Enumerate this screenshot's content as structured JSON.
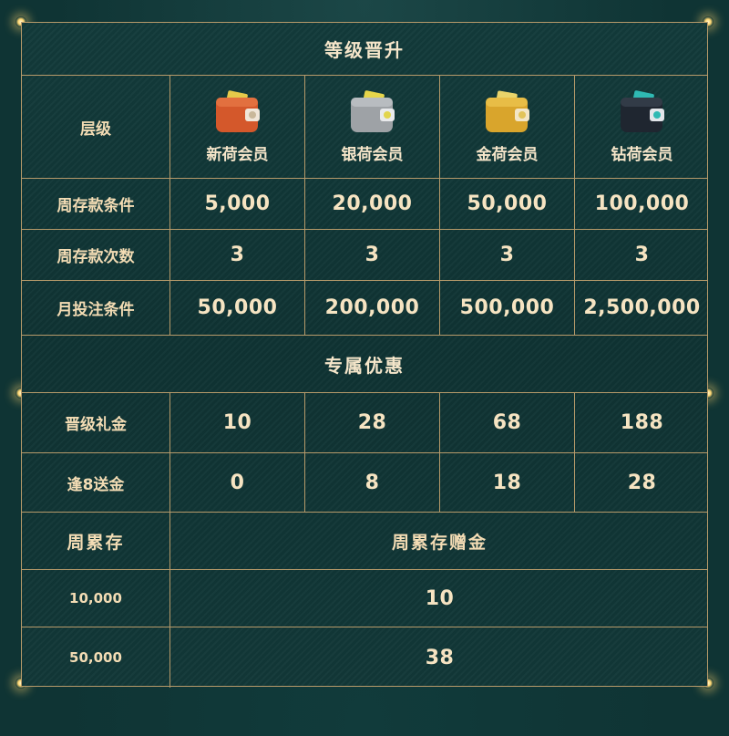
{
  "sections": {
    "promotion_title": "等级晋升",
    "offers_title": "专属优惠"
  },
  "tier_header": {
    "label": "层级",
    "tiers": [
      {
        "name": "新荷会员",
        "icon": "orange-wallet-icon",
        "color": "#d4582b",
        "accent": "#e5c94a"
      },
      {
        "name": "银荷会员",
        "icon": "silver-wallet-icon",
        "color": "#9ea2a6",
        "accent": "#e6d54a"
      },
      {
        "name": "金荷会员",
        "icon": "gold-wallet-icon",
        "color": "#d9a52c",
        "accent": "#e9d46a"
      },
      {
        "name": "钻荷会员",
        "icon": "black-wallet-icon",
        "color": "#1f2630",
        "accent": "#2fb9b3"
      }
    ]
  },
  "promotion_rows": [
    {
      "label": "周存款条件",
      "values": [
        "5,000",
        "20,000",
        "50,000",
        "100,000"
      ]
    },
    {
      "label": "周存款次数",
      "values": [
        "3",
        "3",
        "3",
        "3"
      ]
    },
    {
      "label": "月投注条件",
      "values": [
        "50,000",
        "200,000",
        "500,000",
        "2,500,000"
      ]
    }
  ],
  "offer_rows": [
    {
      "label": "晋级礼金",
      "values": [
        "10",
        "28",
        "68",
        "188"
      ]
    },
    {
      "label": "逢8送金",
      "values": [
        "0",
        "8",
        "18",
        "28"
      ]
    }
  ],
  "weekly": {
    "header_left": "周累存",
    "header_right": "周累存赠金",
    "rows": [
      {
        "deposit": "10,000",
        "bonus": "10"
      },
      {
        "deposit": "50,000",
        "bonus": "38"
      }
    ]
  }
}
